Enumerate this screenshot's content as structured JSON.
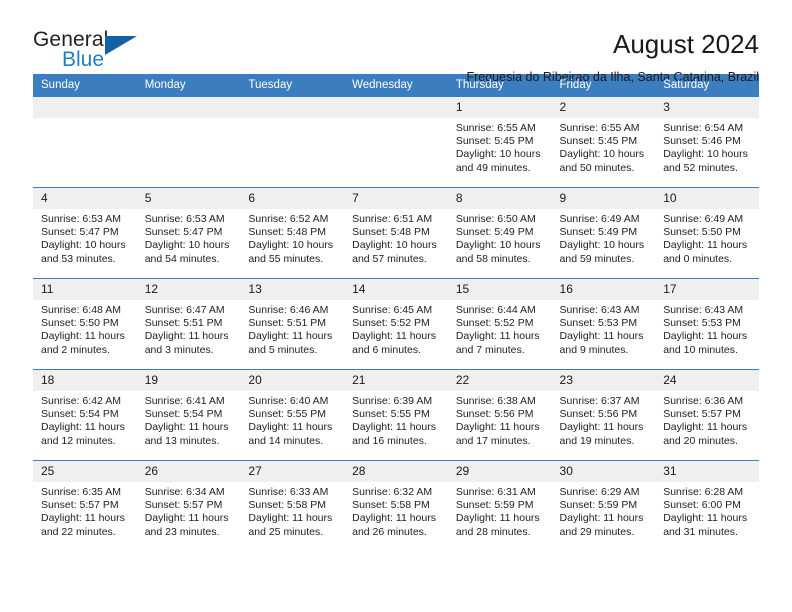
{
  "logo": {
    "word1": "General",
    "word2": "Blue",
    "triangle_color": "#1462a6",
    "blue_text_color": "#1f7fc4"
  },
  "header": {
    "month_title": "August 2024",
    "location": "Freguesia do Ribeirao da Ilha, Santa Catarina, Brazil",
    "header_bg": "#3b7dbf",
    "daynum_bg": "#efefef"
  },
  "weekday_headers": [
    "Sunday",
    "Monday",
    "Tuesday",
    "Wednesday",
    "Thursday",
    "Friday",
    "Saturday"
  ],
  "labels": {
    "sunrise": "Sunrise:",
    "sunset": "Sunset:",
    "daylight": "Daylight:"
  },
  "weeks": [
    [
      {
        "day": "",
        "empty": true
      },
      {
        "day": "",
        "empty": true
      },
      {
        "day": "",
        "empty": true
      },
      {
        "day": "",
        "empty": true
      },
      {
        "day": "1",
        "sunrise": "Sunrise: 6:55 AM",
        "sunset": "Sunset: 5:45 PM",
        "daylight1": "Daylight: 10 hours",
        "daylight2": "and 49 minutes."
      },
      {
        "day": "2",
        "sunrise": "Sunrise: 6:55 AM",
        "sunset": "Sunset: 5:45 PM",
        "daylight1": "Daylight: 10 hours",
        "daylight2": "and 50 minutes."
      },
      {
        "day": "3",
        "sunrise": "Sunrise: 6:54 AM",
        "sunset": "Sunset: 5:46 PM",
        "daylight1": "Daylight: 10 hours",
        "daylight2": "and 52 minutes."
      }
    ],
    [
      {
        "day": "4",
        "sunrise": "Sunrise: 6:53 AM",
        "sunset": "Sunset: 5:47 PM",
        "daylight1": "Daylight: 10 hours",
        "daylight2": "and 53 minutes."
      },
      {
        "day": "5",
        "sunrise": "Sunrise: 6:53 AM",
        "sunset": "Sunset: 5:47 PM",
        "daylight1": "Daylight: 10 hours",
        "daylight2": "and 54 minutes."
      },
      {
        "day": "6",
        "sunrise": "Sunrise: 6:52 AM",
        "sunset": "Sunset: 5:48 PM",
        "daylight1": "Daylight: 10 hours",
        "daylight2": "and 55 minutes."
      },
      {
        "day": "7",
        "sunrise": "Sunrise: 6:51 AM",
        "sunset": "Sunset: 5:48 PM",
        "daylight1": "Daylight: 10 hours",
        "daylight2": "and 57 minutes."
      },
      {
        "day": "8",
        "sunrise": "Sunrise: 6:50 AM",
        "sunset": "Sunset: 5:49 PM",
        "daylight1": "Daylight: 10 hours",
        "daylight2": "and 58 minutes."
      },
      {
        "day": "9",
        "sunrise": "Sunrise: 6:49 AM",
        "sunset": "Sunset: 5:49 PM",
        "daylight1": "Daylight: 10 hours",
        "daylight2": "and 59 minutes."
      },
      {
        "day": "10",
        "sunrise": "Sunrise: 6:49 AM",
        "sunset": "Sunset: 5:50 PM",
        "daylight1": "Daylight: 11 hours",
        "daylight2": "and 0 minutes."
      }
    ],
    [
      {
        "day": "11",
        "sunrise": "Sunrise: 6:48 AM",
        "sunset": "Sunset: 5:50 PM",
        "daylight1": "Daylight: 11 hours",
        "daylight2": "and 2 minutes."
      },
      {
        "day": "12",
        "sunrise": "Sunrise: 6:47 AM",
        "sunset": "Sunset: 5:51 PM",
        "daylight1": "Daylight: 11 hours",
        "daylight2": "and 3 minutes."
      },
      {
        "day": "13",
        "sunrise": "Sunrise: 6:46 AM",
        "sunset": "Sunset: 5:51 PM",
        "daylight1": "Daylight: 11 hours",
        "daylight2": "and 5 minutes."
      },
      {
        "day": "14",
        "sunrise": "Sunrise: 6:45 AM",
        "sunset": "Sunset: 5:52 PM",
        "daylight1": "Daylight: 11 hours",
        "daylight2": "and 6 minutes."
      },
      {
        "day": "15",
        "sunrise": "Sunrise: 6:44 AM",
        "sunset": "Sunset: 5:52 PM",
        "daylight1": "Daylight: 11 hours",
        "daylight2": "and 7 minutes."
      },
      {
        "day": "16",
        "sunrise": "Sunrise: 6:43 AM",
        "sunset": "Sunset: 5:53 PM",
        "daylight1": "Daylight: 11 hours",
        "daylight2": "and 9 minutes."
      },
      {
        "day": "17",
        "sunrise": "Sunrise: 6:43 AM",
        "sunset": "Sunset: 5:53 PM",
        "daylight1": "Daylight: 11 hours",
        "daylight2": "and 10 minutes."
      }
    ],
    [
      {
        "day": "18",
        "sunrise": "Sunrise: 6:42 AM",
        "sunset": "Sunset: 5:54 PM",
        "daylight1": "Daylight: 11 hours",
        "daylight2": "and 12 minutes."
      },
      {
        "day": "19",
        "sunrise": "Sunrise: 6:41 AM",
        "sunset": "Sunset: 5:54 PM",
        "daylight1": "Daylight: 11 hours",
        "daylight2": "and 13 minutes."
      },
      {
        "day": "20",
        "sunrise": "Sunrise: 6:40 AM",
        "sunset": "Sunset: 5:55 PM",
        "daylight1": "Daylight: 11 hours",
        "daylight2": "and 14 minutes."
      },
      {
        "day": "21",
        "sunrise": "Sunrise: 6:39 AM",
        "sunset": "Sunset: 5:55 PM",
        "daylight1": "Daylight: 11 hours",
        "daylight2": "and 16 minutes."
      },
      {
        "day": "22",
        "sunrise": "Sunrise: 6:38 AM",
        "sunset": "Sunset: 5:56 PM",
        "daylight1": "Daylight: 11 hours",
        "daylight2": "and 17 minutes."
      },
      {
        "day": "23",
        "sunrise": "Sunrise: 6:37 AM",
        "sunset": "Sunset: 5:56 PM",
        "daylight1": "Daylight: 11 hours",
        "daylight2": "and 19 minutes."
      },
      {
        "day": "24",
        "sunrise": "Sunrise: 6:36 AM",
        "sunset": "Sunset: 5:57 PM",
        "daylight1": "Daylight: 11 hours",
        "daylight2": "and 20 minutes."
      }
    ],
    [
      {
        "day": "25",
        "sunrise": "Sunrise: 6:35 AM",
        "sunset": "Sunset: 5:57 PM",
        "daylight1": "Daylight: 11 hours",
        "daylight2": "and 22 minutes."
      },
      {
        "day": "26",
        "sunrise": "Sunrise: 6:34 AM",
        "sunset": "Sunset: 5:57 PM",
        "daylight1": "Daylight: 11 hours",
        "daylight2": "and 23 minutes."
      },
      {
        "day": "27",
        "sunrise": "Sunrise: 6:33 AM",
        "sunset": "Sunset: 5:58 PM",
        "daylight1": "Daylight: 11 hours",
        "daylight2": "and 25 minutes."
      },
      {
        "day": "28",
        "sunrise": "Sunrise: 6:32 AM",
        "sunset": "Sunset: 5:58 PM",
        "daylight1": "Daylight: 11 hours",
        "daylight2": "and 26 minutes."
      },
      {
        "day": "29",
        "sunrise": "Sunrise: 6:31 AM",
        "sunset": "Sunset: 5:59 PM",
        "daylight1": "Daylight: 11 hours",
        "daylight2": "and 28 minutes."
      },
      {
        "day": "30",
        "sunrise": "Sunrise: 6:29 AM",
        "sunset": "Sunset: 5:59 PM",
        "daylight1": "Daylight: 11 hours",
        "daylight2": "and 29 minutes."
      },
      {
        "day": "31",
        "sunrise": "Sunrise: 6:28 AM",
        "sunset": "Sunset: 6:00 PM",
        "daylight1": "Daylight: 11 hours",
        "daylight2": "and 31 minutes."
      }
    ]
  ]
}
